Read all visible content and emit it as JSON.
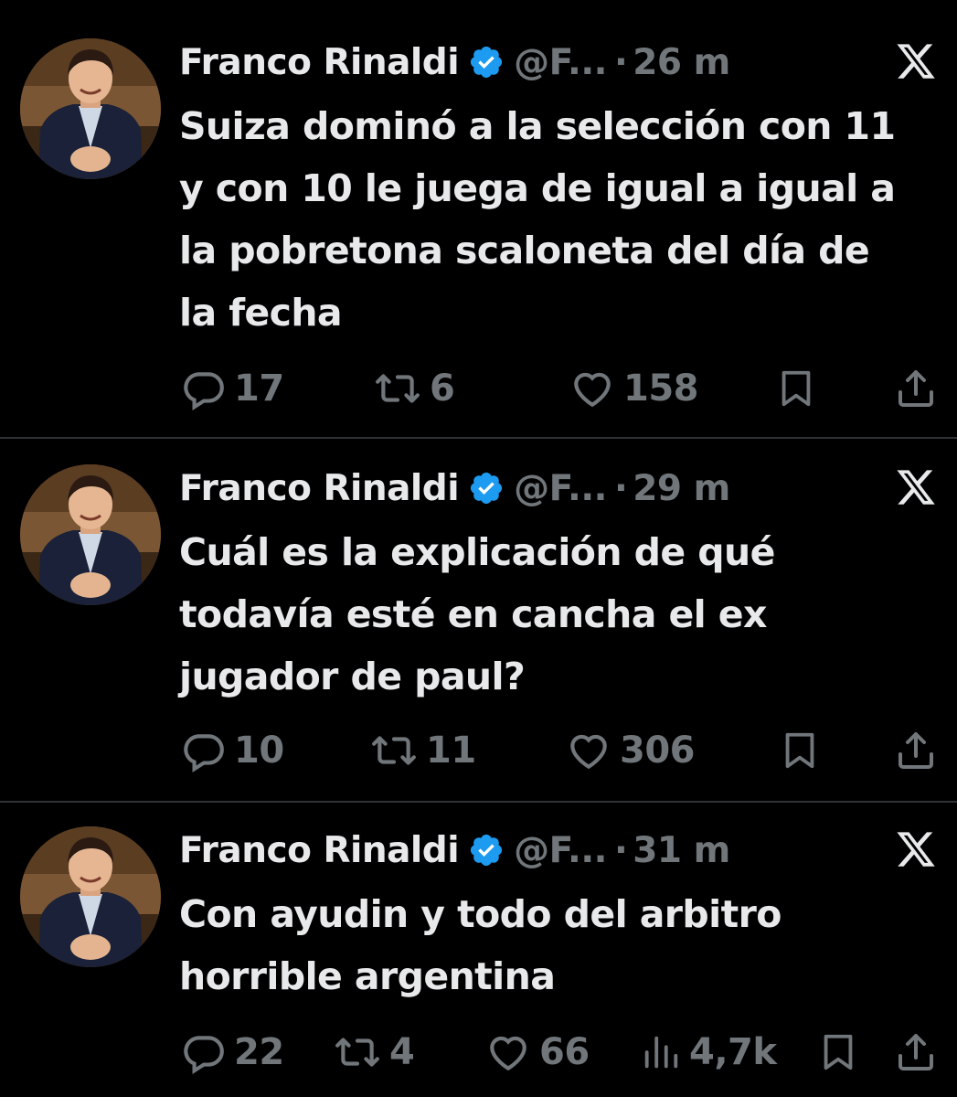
{
  "tweets": [
    {
      "author": "Franco Rinaldi",
      "handle": "@F...",
      "separator": "·",
      "time": "26 m",
      "lines": [
        "Suiza dominó a la selección con 11",
        "y con 10 le juega de igual a igual a",
        "la pobretona scaloneta del día de",
        "la fecha"
      ],
      "replies": "17",
      "reposts": "6",
      "likes": "158"
    },
    {
      "author": "Franco Rinaldi",
      "handle": "@F...",
      "separator": "·",
      "time": "29 m",
      "lines": [
        "Cuál es la explicación de qué",
        "todavía esté en cancha el ex",
        "jugador de paul?"
      ],
      "replies": "10",
      "reposts": "11",
      "likes": "306"
    },
    {
      "author": "Franco Rinaldi",
      "handle": "@F...",
      "separator": "·",
      "time": "31 m",
      "lines": [
        "Con ayudin y todo del arbitro",
        "horrible argentina"
      ],
      "replies": "22",
      "reposts": "4",
      "likes": "66",
      "views": "4,7k"
    }
  ],
  "colors": {
    "background": "#000000",
    "text": "#e7e9ea",
    "muted": "#71767b",
    "verified": "#1d9bf0",
    "divider": "#2f3336"
  },
  "icons": [
    "verified-badge-icon",
    "x-logo-icon",
    "reply-icon",
    "repost-icon",
    "like-icon",
    "views-icon",
    "bookmark-icon",
    "share-icon"
  ]
}
